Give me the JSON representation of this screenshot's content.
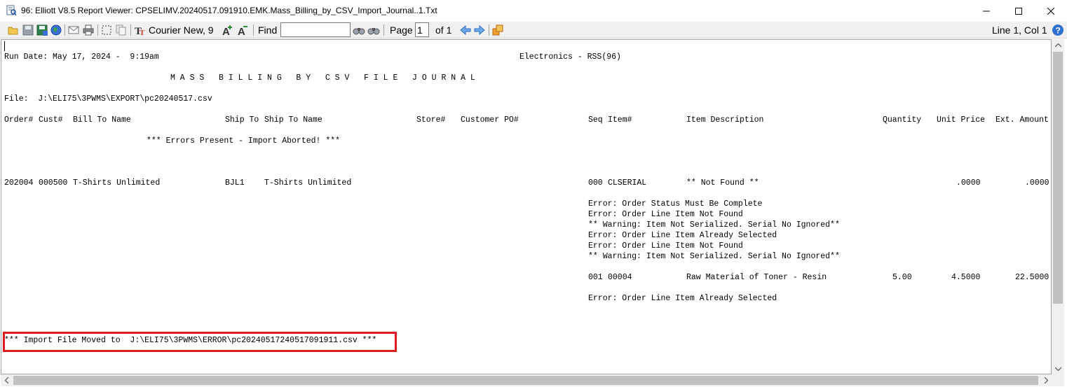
{
  "window": {
    "title": "96: Elliott V8.5 Report Viewer: CPSELIMV.20240517.091910.EMK.Mass_Billing_by_CSV_Import_Journal..1.Txt",
    "icon": "report-viewer-icon"
  },
  "toolbar": {
    "font": "Courier New, 9",
    "find_label": "Find",
    "find_value": "",
    "page_label": "Page",
    "page_value": "1",
    "of_pages": "of 1",
    "position": "Line 1, Col 1",
    "icons": [
      "open-icon",
      "save-icon",
      "save-as-icon",
      "web-icon",
      "email-icon",
      "print-icon",
      "select-all-icon",
      "copy-icon",
      "font-icon",
      "font-larger-icon",
      "font-smaller-icon",
      "find-next-icon",
      "find-prev-icon",
      "prev-page-icon",
      "next-page-icon",
      "export-icon",
      "help-icon"
    ]
  },
  "report": {
    "run_date": "Run Date: May 17, 2024 -  9:19am",
    "company": "Electronics - RSS(96)",
    "heading": "M A S S   B I L L I N G   B Y   C S V   F I L E   J O U R N A L",
    "file": "File:  J:\\ELI75\\3PWMS\\EXPORT\\pc20240517.csv",
    "columns": {
      "order": "Order#",
      "cust": "Cust#",
      "bill_to": "Bill To Name",
      "ship_to": "Ship To",
      "ship_to_name": "Ship To Name",
      "store": "Store#",
      "po": "Customer PO#",
      "seq": "Seq",
      "item": "Item#",
      "desc": "Item Description",
      "qty": "Quantity",
      "price": "Unit Price",
      "ext": "Ext. Amount"
    },
    "errors_banner": "*** Errors Present - Import Aborted! ***",
    "order_line": {
      "order": "202004",
      "cust": "000500",
      "bill_to": "T-Shirts Unlimited",
      "ship_to": "BJL1",
      "ship_to_name": "T-Shirts Unlimited",
      "seq": "000",
      "item": "CLSERIAL",
      "desc": "** Not Found **",
      "price": ".0000",
      "ext": ".0000"
    },
    "messages_1": [
      "Error: Order Status Must Be Complete",
      "Error: Order Line Item Not Found",
      "** Warning: Item Not Serialized. Serial No Ignored**",
      "Error: Order Line Item Already Selected",
      "Error: Order Line Item Not Found",
      "** Warning: Item Not Serialized. Serial No Ignored**"
    ],
    "line_2": {
      "seq": "001",
      "item": "00004",
      "desc": "Raw Material of Toner - Resin",
      "qty": "5.00",
      "price": "4.5000",
      "ext": "22.5000"
    },
    "messages_2": [
      "Error: Order Line Item Already Selected"
    ],
    "moved": "*** Import File Moved to  J:\\ELI75\\3PWMS\\ERROR\\pc20240517240517091911.csv ***"
  },
  "colors": {
    "highlight": "#e0191f",
    "toolbar_bg": "#f0f0f0"
  }
}
